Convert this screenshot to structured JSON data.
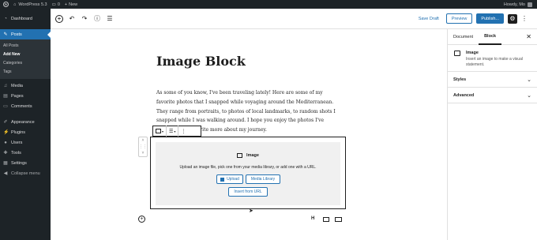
{
  "admin_bar": {
    "site_name": "WordPress 5.3",
    "comments_count": "0",
    "new_label": "New",
    "greeting": "Howdy, Mo"
  },
  "sidebar": {
    "items": [
      {
        "label": "Dashboard",
        "icon": "dashboard-icon"
      },
      {
        "label": "Posts",
        "icon": "pin-icon",
        "active": true
      },
      {
        "label": "Media",
        "icon": "media-icon"
      },
      {
        "label": "Pages",
        "icon": "pages-icon"
      },
      {
        "label": "Comments",
        "icon": "comments-icon"
      },
      {
        "label": "Appearance",
        "icon": "brush-icon"
      },
      {
        "label": "Plugins",
        "icon": "plug-icon"
      },
      {
        "label": "Users",
        "icon": "user-icon"
      },
      {
        "label": "Tools",
        "icon": "wrench-icon"
      },
      {
        "label": "Settings",
        "icon": "settings-icon"
      },
      {
        "label": "Collapse menu",
        "icon": "collapse-icon"
      }
    ],
    "posts_submenu": [
      "All Posts",
      "Add New",
      "Categories",
      "Tags"
    ],
    "current_submenu": "Add New"
  },
  "toolbar": {
    "save_draft": "Save Draft",
    "preview": "Preview",
    "publish": "Publish..."
  },
  "panel": {
    "tabs": [
      "Document",
      "Block"
    ],
    "active_tab": "Block",
    "block_title": "Image",
    "block_desc": "Insert an image to make a visual statement.",
    "sections": [
      "Styles",
      "Advanced"
    ]
  },
  "post": {
    "title": "Image Block",
    "paragraph_lines": [
      "As some of you know, I've been traveling lately! Here are some of my",
      "favorite photos that I snapped while voyaging around the Mediterranean.",
      "They range from portraits, to photos of local landmarks, to random shots I",
      "snapped while I was walking around. I hope you enjoy the photos I've",
      "it to write more about my journey."
    ]
  },
  "image_block": {
    "title": "Image",
    "instructions": "Upload an image file, pick one from your media library, or add one with a URL.",
    "upload": "Upload",
    "media_library": "Media Library",
    "insert_url": "Insert from URL"
  },
  "colors": {
    "accent": "#2271b1",
    "admin_dark": "#1d2327",
    "placeholder_bg": "#f0f0f0"
  }
}
